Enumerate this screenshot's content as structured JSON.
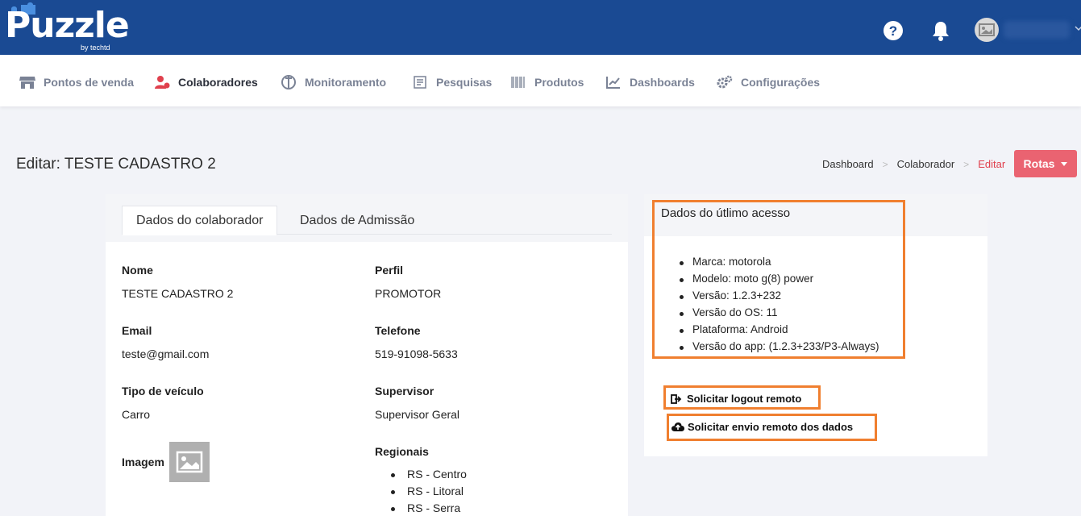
{
  "header": {
    "logo_text": "Puzzle",
    "logo_sub": "by techtd",
    "icons": [
      "help-icon",
      "bell-icon",
      "avatar-image-icon",
      "chevron-down-icon"
    ],
    "colors": {
      "topbar": "#1a4a93",
      "accent": "#ea6371",
      "highlight": "#f07f2f"
    }
  },
  "nav": {
    "items": [
      {
        "label": "Pontos de venda",
        "icon": "store-icon"
      },
      {
        "label": "Colaboradores",
        "icon": "users-icon",
        "active": true
      },
      {
        "label": "Monitoramento",
        "icon": "monitor-icon"
      },
      {
        "label": "Pesquisas",
        "icon": "survey-icon"
      },
      {
        "label": "Produtos",
        "icon": "barcode-icon"
      },
      {
        "label": "Dashboards",
        "icon": "chart-icon"
      },
      {
        "label": "Configurações",
        "icon": "gears-icon"
      }
    ]
  },
  "page": {
    "title": "Editar: TESTE CADASTRO 2",
    "breadcrumb": [
      "Dashboard",
      "Colaborador",
      "Editar"
    ],
    "rotas_label": "Rotas"
  },
  "tabs": [
    "Dados do colaborador",
    "Dados de Admissão"
  ],
  "fields": {
    "nome_label": "Nome",
    "nome": "TESTE CADASTRO 2",
    "perfil_label": "Perfil",
    "perfil": "PROMOTOR",
    "email_label": "Email",
    "email": "teste@gmail.com",
    "telefone_label": "Telefone",
    "telefone": "519-91098-5633",
    "veiculo_label": "Tipo de veículo",
    "veiculo": "Carro",
    "supervisor_label": "Supervisor",
    "supervisor": "Supervisor Geral",
    "imagem_label": "Imagem",
    "regionais_label": "Regionais",
    "regionais": [
      "RS - Centro",
      "RS - Litoral",
      "RS - Serra"
    ]
  },
  "access": {
    "title": "Dados do útlimo acesso",
    "items": [
      "Marca: motorola",
      "Modelo: moto g(8) power",
      "Versão: 1.2.3+232",
      "Versão do OS: 11",
      "Plataforma: Android",
      "Versão do app: (1.2.3+233/P3-Always)"
    ]
  },
  "actions": {
    "logout": "Solicitar logout remoto",
    "envio": "Solicitar envio remoto dos dados"
  }
}
